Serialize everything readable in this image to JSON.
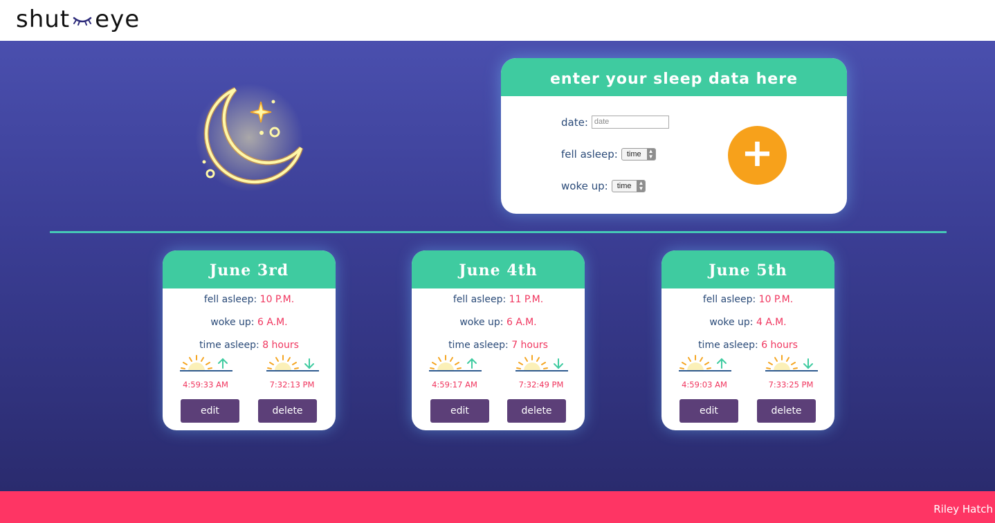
{
  "header": {
    "logo_left": "shut",
    "logo_right": "eye"
  },
  "form": {
    "title": "enter your sleep data here",
    "date_label": "date:",
    "date_placeholder": "date",
    "fell_asleep_label": "fell asleep:",
    "fell_asleep_value": "time",
    "woke_up_label": "woke up:",
    "woke_up_value": "time",
    "add_symbol": "+"
  },
  "colors": {
    "accent": "#3fcba0",
    "highlight": "#f0355e",
    "button": "#5c3f78",
    "add": "#f7a11b",
    "footer": "#fe3564"
  },
  "cards": [
    {
      "date": "June 3rd",
      "fell_asleep_label": "fell asleep:",
      "fell_asleep": "10 P.M.",
      "woke_up_label": "woke up:",
      "woke_up": "6 A.M.",
      "time_asleep_label": "time asleep:",
      "time_asleep": "8 hours",
      "sunrise": "4:59:33 AM",
      "sunset": "7:32:13 PM",
      "edit": "edit",
      "delete": "delete"
    },
    {
      "date": "June 4th",
      "fell_asleep_label": "fell asleep:",
      "fell_asleep": "11 P.M.",
      "woke_up_label": "woke up:",
      "woke_up": "6 A.M.",
      "time_asleep_label": "time asleep:",
      "time_asleep": "7 hours",
      "sunrise": "4:59:17 AM",
      "sunset": "7:32:49 PM",
      "edit": "edit",
      "delete": "delete"
    },
    {
      "date": "June 5th",
      "fell_asleep_label": "fell asleep:",
      "fell_asleep": "10 P.M.",
      "woke_up_label": "woke up:",
      "woke_up": "4 A.M.",
      "time_asleep_label": "time asleep:",
      "time_asleep": "6 hours",
      "sunrise": "4:59:03 AM",
      "sunset": "7:33:25 PM",
      "edit": "edit",
      "delete": "delete"
    }
  ],
  "footer": {
    "author": "Riley Hatch"
  }
}
